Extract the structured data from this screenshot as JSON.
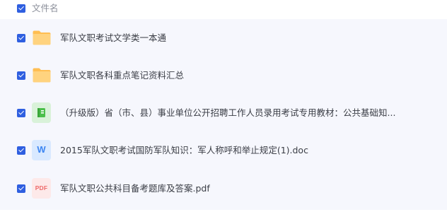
{
  "header": {
    "column_label": "文件名",
    "select_all_checked": true
  },
  "files": [
    {
      "name": "军队文职考试文学类一本通",
      "type": "folder-icon",
      "checked": true
    },
    {
      "name": "军队文职各科重点笔记资料汇总",
      "type": "folder-icon",
      "checked": true
    },
    {
      "name": "（升级版）省（市、县）事业单位公开招聘工作人员录用考试专用教材：公共基础知...",
      "type": "book-icon",
      "checked": true
    },
    {
      "name": "2015军队文职考试国防军队知识：军人称呼和举止规定(1).doc",
      "type": "word-doc-icon",
      "icon_text": "W",
      "checked": true
    },
    {
      "name": "军队文职公共科目备考题库及答案.pdf",
      "type": "pdf-icon",
      "icon_text": "PDF",
      "checked": true
    }
  ],
  "colors": {
    "checkbox": "#2f5fe0",
    "list_background": "#f6f7fd",
    "folder": "#ffc96b",
    "word": "#3d86f2",
    "pdf": "#ee6a6a",
    "book": "#4bbf4b"
  }
}
